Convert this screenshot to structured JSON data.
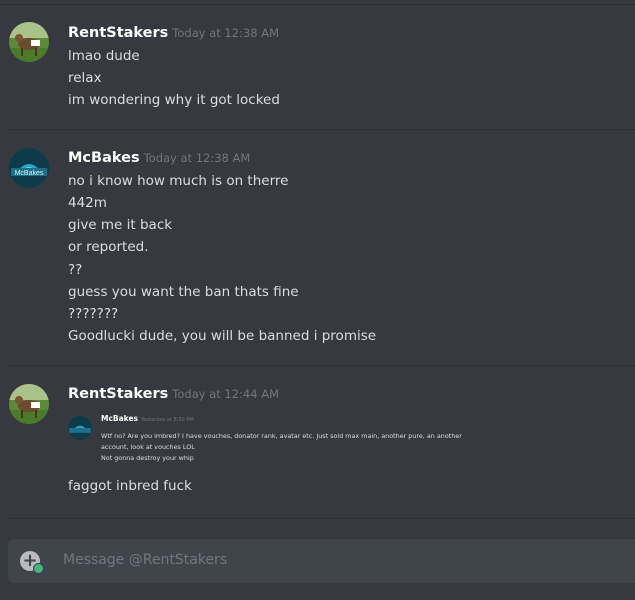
{
  "messages": [
    {
      "username": "RentStakers",
      "timestamp": "Today at 12:38 AM",
      "avatar_icon": "goat-avatar",
      "lines": [
        "lmao dude",
        "relax",
        "im wondering why it got locked"
      ]
    },
    {
      "username": "McBakes",
      "timestamp": "Today at 12:38 AM",
      "avatar_icon": "mcbakes-logo-avatar",
      "lines": [
        "no i know how much is on therre",
        "442m",
        "give me it back",
        "or reported.",
        "??",
        "guess you want the ban thats fine",
        "???????",
        "Goodlucki dude, you will be banned i promise"
      ]
    },
    {
      "username": "RentStakers",
      "timestamp": "Today at 12:44 AM",
      "avatar_icon": "goat-avatar",
      "embed": {
        "username": "McBakes",
        "timestamp": "Yesterday at 8:50 PM",
        "lines": [
          "Wtf no? Are you imbred? I have vouches, donator rank, avatar etc. Just sold max main, another pure, an another",
          "account, look at vouches LOL",
          "Not gonna destroy your whip"
        ]
      },
      "lines": [
        "faggot inbred fuck"
      ]
    }
  ],
  "composer": {
    "placeholder": "Message @RentStakers"
  },
  "colors": {
    "background": "#36393f",
    "composer_bg": "#40444b",
    "username": "#ffffff",
    "timestamp": "#72767d",
    "text": "#dcddde",
    "status_green": "#43b581"
  }
}
